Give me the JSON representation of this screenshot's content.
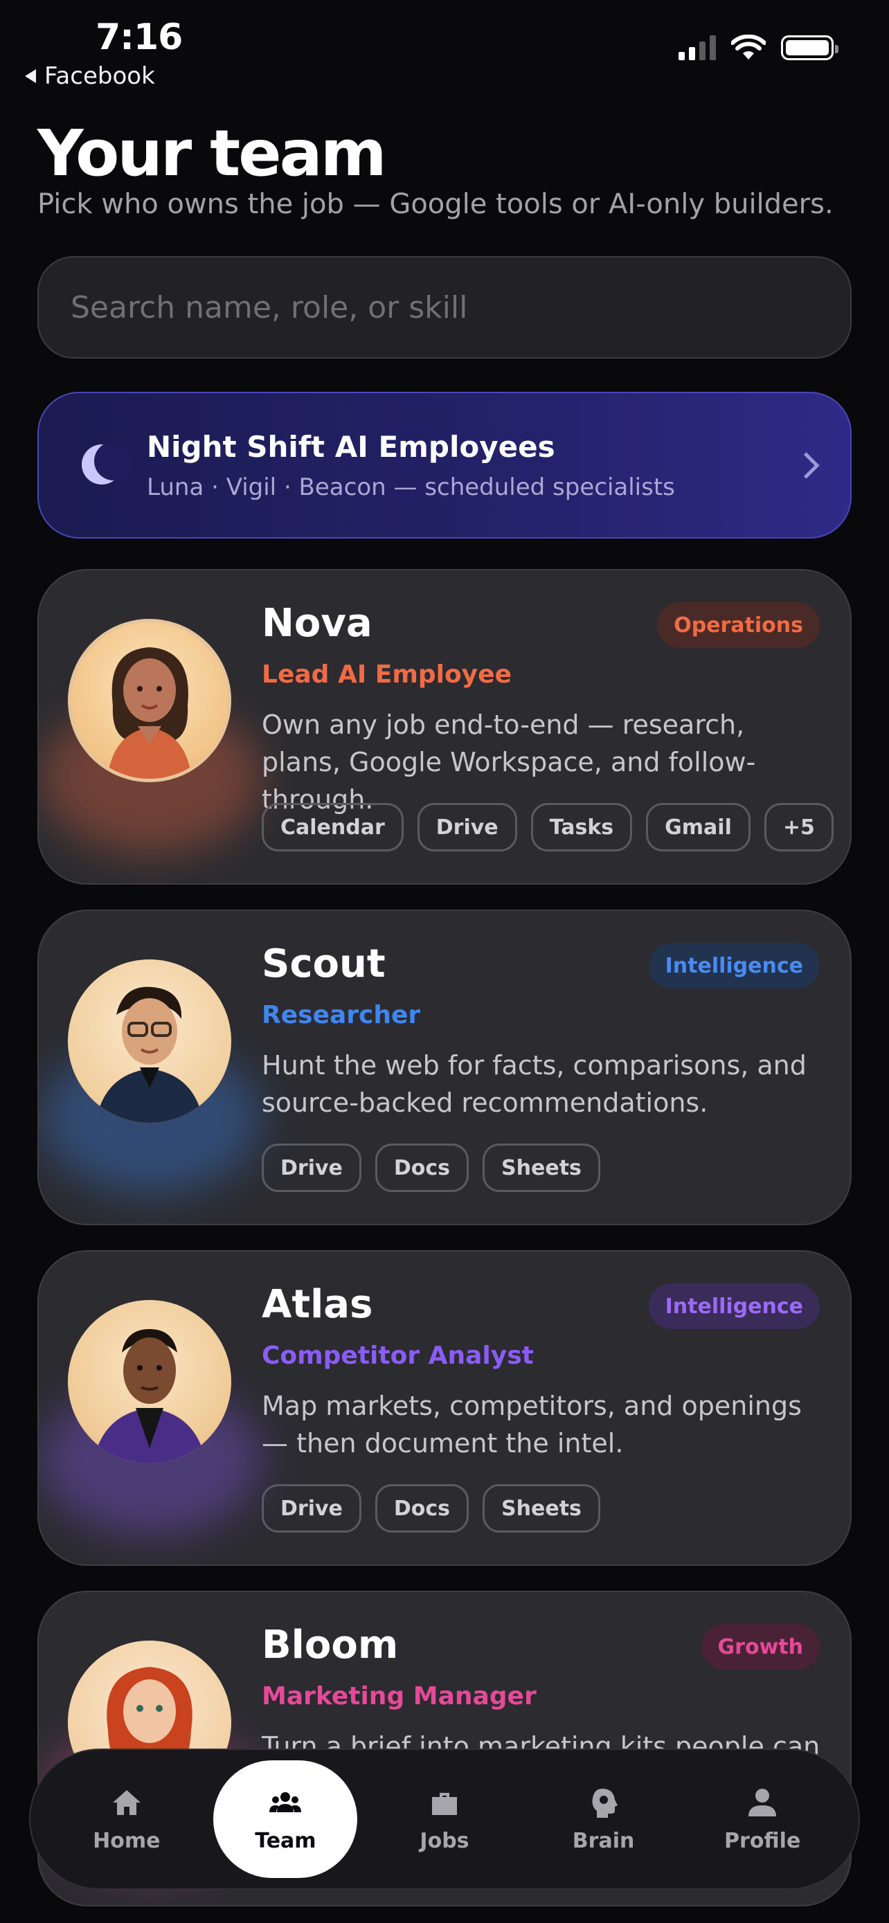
{
  "status_bar": {
    "time": "7:16",
    "back_label": "Facebook"
  },
  "header": {
    "title": "Your team",
    "subtitle": "Pick who owns the job — Google tools or AI-only builders."
  },
  "search": {
    "placeholder": "Search name, role, or skill",
    "value": ""
  },
  "night_shift": {
    "title": "Night Shift AI Employees",
    "subtitle": "Luna · Vigil · Beacon — scheduled specialists"
  },
  "team": [
    {
      "name": "Nova",
      "role": "Lead AI Employee",
      "role_color": "#f06b45",
      "badge": "Operations",
      "badge_color": "#f06b45",
      "badge_bg": "#4a2a26",
      "description": "Own any job end-to-end — research, plans, Google Workspace, and follow-through.",
      "tags": [
        "Calendar",
        "Drive",
        "Tasks",
        "Gmail",
        "+5"
      ]
    },
    {
      "name": "Scout",
      "role": "Researcher",
      "role_color": "#3f86f0",
      "badge": "Intelligence",
      "badge_color": "#4a8bf2",
      "badge_bg": "#22334f",
      "description": "Hunt the web for facts, comparisons, and source-backed recommendations.",
      "tags": [
        "Drive",
        "Docs",
        "Sheets"
      ]
    },
    {
      "name": "Atlas",
      "role": "Competitor Analyst",
      "role_color": "#8b5cf6",
      "badge": "Intelligence",
      "badge_color": "#9b6bf6",
      "badge_bg": "#3a2c58",
      "description": "Map markets, competitors, and openings — then document the intel.",
      "tags": [
        "Drive",
        "Docs",
        "Sheets"
      ]
    },
    {
      "name": "Bloom",
      "role": "Marketing Manager",
      "role_color": "#e44a97",
      "badge": "Growth",
      "badge_color": "#e44a97",
      "badge_bg": "#4a2236",
      "description": "Turn a brief into marketing kits people can",
      "tags": []
    }
  ],
  "nav": [
    {
      "label": "Home",
      "icon": "home-icon",
      "active": false
    },
    {
      "label": "Team",
      "icon": "team-icon",
      "active": true
    },
    {
      "label": "Jobs",
      "icon": "briefcase-icon",
      "active": false
    },
    {
      "label": "Brain",
      "icon": "brain-icon",
      "active": false
    },
    {
      "label": "Profile",
      "icon": "profile-icon",
      "active": false
    }
  ]
}
